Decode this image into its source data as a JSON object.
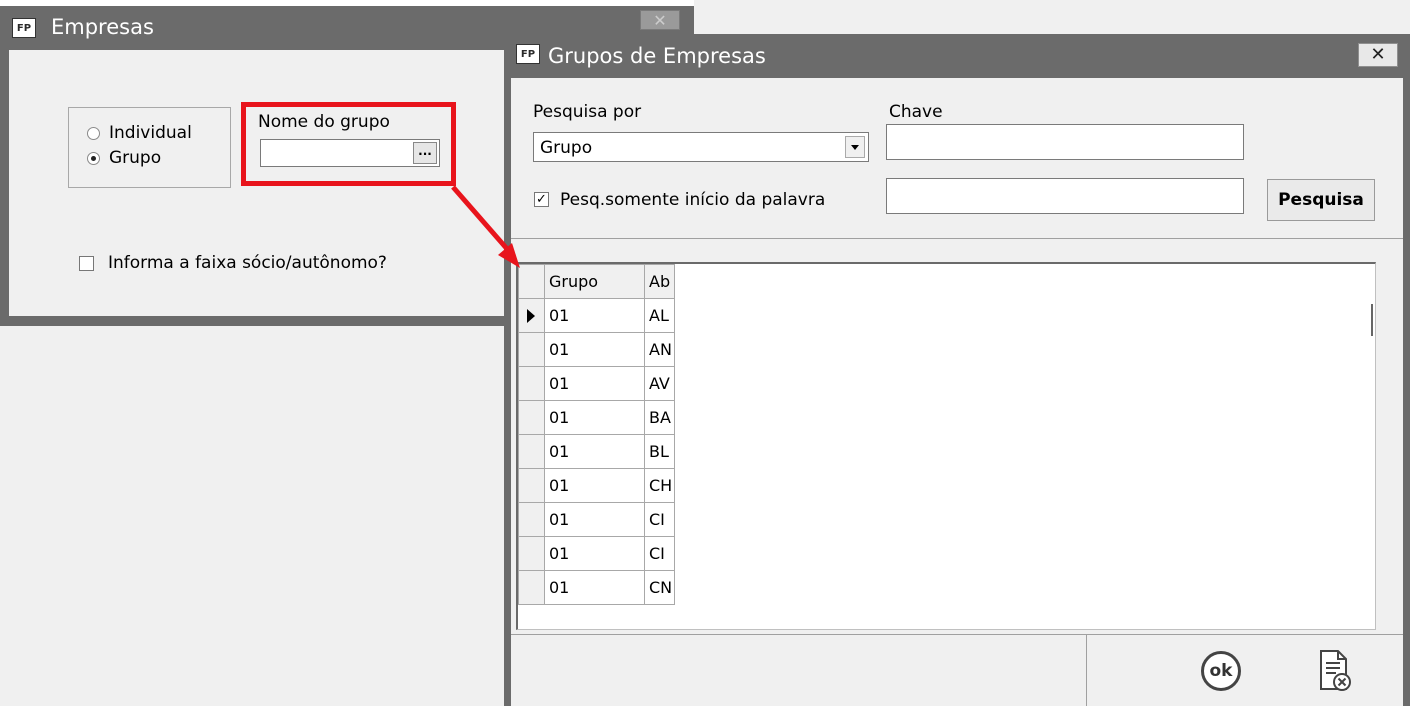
{
  "empresas_window": {
    "title": "Empresas",
    "app_icon": "FP",
    "close_glyph": "✕",
    "radio_individual": "Individual",
    "radio_grupo": "Grupo",
    "selected_radio": "Grupo",
    "nome_do_grupo_label": "Nome do grupo",
    "nome_do_grupo_value": "",
    "ellipsis": "...",
    "faixa_checkbox_label": "Informa a faixa sócio/autônomo?",
    "faixa_checked": false
  },
  "grupos_window": {
    "title": "Grupos de Empresas",
    "app_icon": "FP",
    "close_glyph": "✕",
    "pesquisa_por_label": "Pesquisa por",
    "pesquisa_por_value": "Grupo",
    "chave_label": "Chave",
    "chave_value": "",
    "chave2_value": "",
    "pesq_inicio_label": "Pesq.somente início da palavra",
    "pesq_inicio_checked": true,
    "check_glyph": "✓",
    "pesquisa_button": "Pesquisa",
    "grid": {
      "columns": [
        "Grupo",
        "Ab"
      ],
      "rows": [
        [
          "01",
          "AL"
        ],
        [
          "01",
          "AN"
        ],
        [
          "01",
          "AV"
        ],
        [
          "01",
          "BA"
        ],
        [
          "01",
          "BL"
        ],
        [
          "01",
          "CH"
        ],
        [
          "01",
          "CI"
        ],
        [
          "01",
          "CI"
        ],
        [
          "01",
          "CN"
        ]
      ],
      "current_row": 0
    },
    "ok_button": "ok",
    "ok_icon": "ok-circle-icon",
    "cancel_icon": "cancel-document-icon"
  },
  "colors": {
    "titlebar": "#6b6b6b",
    "highlight": "#e8141c",
    "window_bg": "#f0f0f0"
  }
}
